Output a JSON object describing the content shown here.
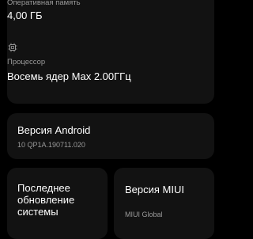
{
  "memory": {
    "label": "Оперативная память",
    "value": "4,00 ГБ"
  },
  "processor": {
    "icon": "chip-icon",
    "label": "Процессор",
    "value": "Восемь ядер Max 2.00ГГц"
  },
  "android": {
    "title": "Версия Android",
    "value": "10 QP1A.190711.020"
  },
  "update": {
    "title_line1": "Последнее",
    "title_line2": "обновление",
    "title_line3": "системы"
  },
  "miui": {
    "title": "Версия MIUI",
    "value": "MIUI Global"
  }
}
